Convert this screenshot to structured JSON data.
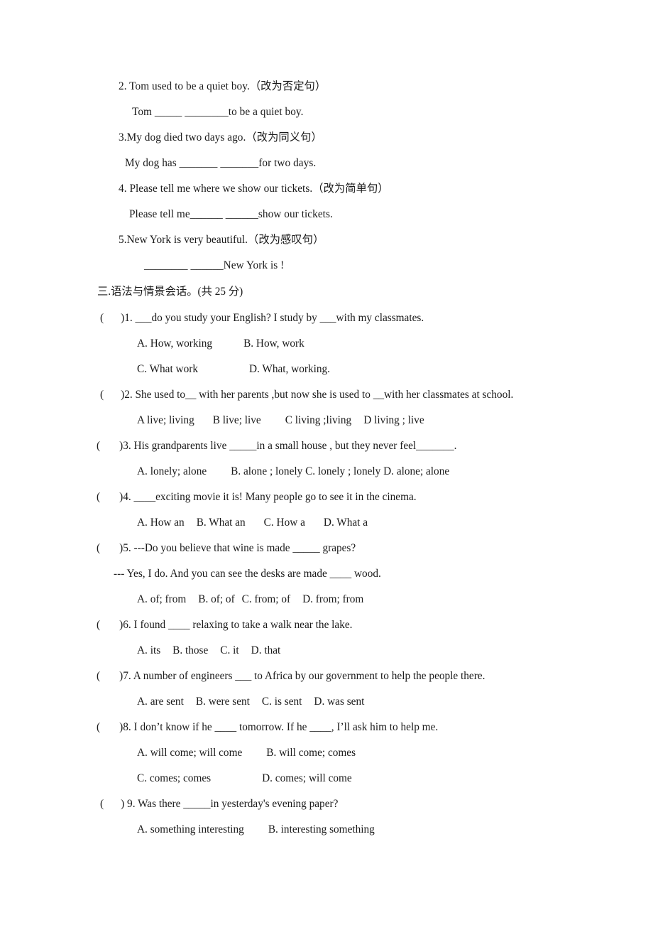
{
  "document": {
    "type": "english-exam-worksheet",
    "page_background": "#ffffff",
    "text_color": "#1a1a1a"
  },
  "sentence_transform": {
    "items": [
      {
        "stem": "2. Tom used to be a quiet boy.（改为否定句）",
        "answer": "Tom    _____  ________to be a quiet boy."
      },
      {
        "stem": "3.My dog died two days ago.（改为同义句）",
        "answer": "My dog has  _______  _______for two days."
      },
      {
        "stem": "4. Please tell me where we show our tickets.（改为简单句）",
        "answer": "Please tell me______  ______show our   tickets."
      },
      {
        "stem": "5.New York is very beautiful.（改为感叹句）",
        "answer": "________  ______New York is !"
      }
    ]
  },
  "section_three": {
    "heading": "三.语法与情景会话。(共 25 分)",
    "questions": [
      {
        "paren_open": "(",
        "paren_close": ")",
        "number": "1.",
        "stem": "___do you study your English? I study by ___with my classmates.",
        "option_lines": [
          {
            "parts": [
              "A. How, working",
              "B. How, work"
            ]
          },
          {
            "parts": [
              "C. What work",
              "D. What, working."
            ]
          }
        ]
      },
      {
        "paren_open": "(",
        "paren_close": ")",
        "number": "2.",
        "stem": "She used to__ with her parents ,but now she is used to __with her classmates at school.",
        "option_lines": [
          {
            "parts": [
              "A live; living",
              "B live; live",
              "C living ;living",
              "D living ; live"
            ]
          }
        ]
      },
      {
        "paren_open": "(",
        "paren_close": ")",
        "number": "3.",
        "stem": "His grandparents live _____in a small house , but they never feel_______.",
        "option_lines": [
          {
            "parts": [
              "A. lonely; alone",
              "B. alone ; lonely C. lonely ; lonely D. alone; alone"
            ]
          }
        ]
      },
      {
        "paren_open": "(",
        "paren_close": ")",
        "number": "4.",
        "stem": "____exciting movie it is! Many people go to see it in the cinema.",
        "option_lines": [
          {
            "parts": [
              "A. How an",
              "B. What an",
              "C. How   a",
              "D. What a"
            ]
          }
        ]
      },
      {
        "paren_open": "(",
        "paren_close": ")",
        "number": "5.",
        "stem": "---Do you believe that wine is made _____ grapes?",
        "reply": "--- Yes, I do. And you can see the desks are made ____ wood.",
        "option_lines": [
          {
            "parts": [
              "A. of; from",
              "B. of; of",
              "C. from; of",
              "D. from; from"
            ]
          }
        ]
      },
      {
        "paren_open": "(",
        "paren_close": ")",
        "number": "6.",
        "stem": "I found ____ relaxing to take a walk near the lake.",
        "option_lines": [
          {
            "parts": [
              "A. its",
              "B. those",
              "C. it",
              "D. that"
            ]
          }
        ]
      },
      {
        "paren_open": "(",
        "paren_close": ")",
        "number": "7.",
        "stem": "A number of engineers ___ to Africa by our government to help the people there.",
        "option_lines": [
          {
            "parts": [
              "A. are sent",
              "B. were sent",
              "C. is sent",
              "D. was sent"
            ]
          }
        ]
      },
      {
        "paren_open": "(",
        "paren_close": ")",
        "number": "8.",
        "stem": "I don’t know if he ____ tomorrow. If he ____, I’ll ask him to help me.",
        "option_lines": [
          {
            "parts": [
              "A. will come; will come",
              "B. will come; comes"
            ]
          },
          {
            "parts": [
              "C. comes; comes",
              "D. comes; will come"
            ]
          }
        ]
      },
      {
        "paren_open": "(",
        "paren_close": ")",
        "number": "9.",
        "stem": "Was there _____in yesterday's evening paper?",
        "option_lines": [
          {
            "parts": [
              "A. something interesting",
              "B. interesting something"
            ]
          }
        ]
      }
    ]
  }
}
